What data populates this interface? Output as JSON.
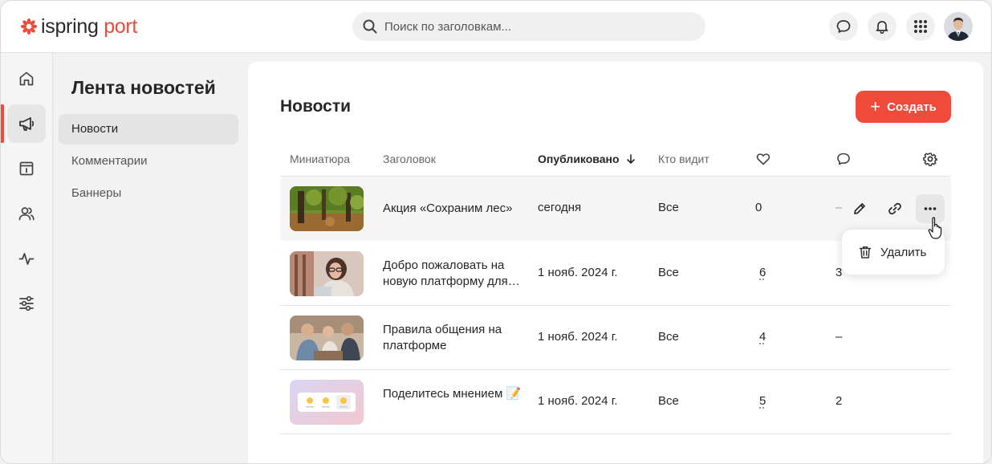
{
  "brand": {
    "name_part1": "ispring",
    "name_part2": "port",
    "accent": "#ef4a3a"
  },
  "search": {
    "placeholder": "Поиск по заголовкам..."
  },
  "topbar_icons": [
    "chat-icon",
    "bell-icon",
    "apps-grid-icon",
    "avatar"
  ],
  "rail": {
    "items": [
      {
        "name": "home-icon",
        "active": false
      },
      {
        "name": "megaphone-icon",
        "active": true
      },
      {
        "name": "calendar-info-icon",
        "active": false
      },
      {
        "name": "users-icon",
        "active": false
      },
      {
        "name": "activity-icon",
        "active": false
      },
      {
        "name": "settings-sliders-icon",
        "active": false
      }
    ]
  },
  "section": {
    "title": "Лента новостей",
    "items": [
      {
        "label": "Новости",
        "active": true
      },
      {
        "label": "Комментарии",
        "active": false
      },
      {
        "label": "Баннеры",
        "active": false
      }
    ]
  },
  "main": {
    "title": "Новости",
    "create_label": "Создать",
    "columns": {
      "thumbnail": "Миниатюра",
      "title": "Заголовок",
      "published": "Опубликовано",
      "audience": "Кто видит"
    },
    "rows": [
      {
        "title": "Акция «Сохраним лес»",
        "published": "сегодня",
        "audience": "Все",
        "likes": "0",
        "comments": "–"
      },
      {
        "title": "Добро пожаловать на новую платформу для…",
        "published": "1 нояб. 2024 г.",
        "audience": "Все",
        "likes": "6",
        "comments": "3"
      },
      {
        "title": "Правила общения на платформе",
        "published": "1 нояб. 2024 г.",
        "audience": "Все",
        "likes": "4",
        "comments": "–"
      },
      {
        "title": "Поделитесь мнением 📝",
        "published": "1 нояб. 2024 г.",
        "audience": "Все",
        "likes": "5",
        "comments": "2"
      }
    ]
  },
  "context_menu": {
    "delete_label": "Удалить"
  }
}
